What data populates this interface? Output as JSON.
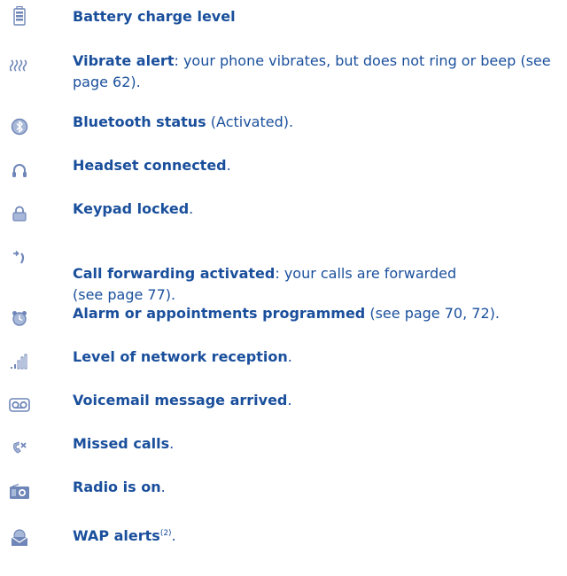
{
  "colors": {
    "text": "#1a4f9c",
    "icon": "#6f86b8",
    "icon_light": "#a8b8d8"
  },
  "items": [
    {
      "icon": "battery-icon",
      "label": "Battery charge level",
      "desc": ""
    },
    {
      "icon": "vibrate-icon",
      "label": "Vibrate alert",
      "desc": ": your phone vibrates, but does not ring or beep (see page 62)."
    },
    {
      "icon": "bluetooth-icon",
      "label": "Bluetooth status",
      "desc": " (Activated)."
    },
    {
      "icon": "headset-icon",
      "label": "Headset connected",
      "desc": "."
    },
    {
      "icon": "keypad-lock-icon",
      "label": "Keypad locked",
      "desc": "."
    },
    {
      "icon": "call-forward-icon",
      "label": "Call forwarding activated",
      "desc": ": your calls are forwarded\n(see page 77)."
    },
    {
      "icon": "alarm-clock-icon",
      "label": "Alarm or appointments programmed",
      "desc": " (see page 70, 72)."
    },
    {
      "icon": "signal-bars-icon",
      "label": "Level of network reception",
      "desc": "."
    },
    {
      "icon": "voicemail-icon",
      "label": "Voicemail message arrived",
      "desc": "."
    },
    {
      "icon": "missed-call-icon",
      "label": "Missed calls",
      "desc": "."
    },
    {
      "icon": "radio-icon",
      "label": "Radio is on",
      "desc": "."
    },
    {
      "icon": "wap-alert-icon",
      "label": "WAP alerts",
      "sup": "(2)",
      "desc": "."
    }
  ]
}
